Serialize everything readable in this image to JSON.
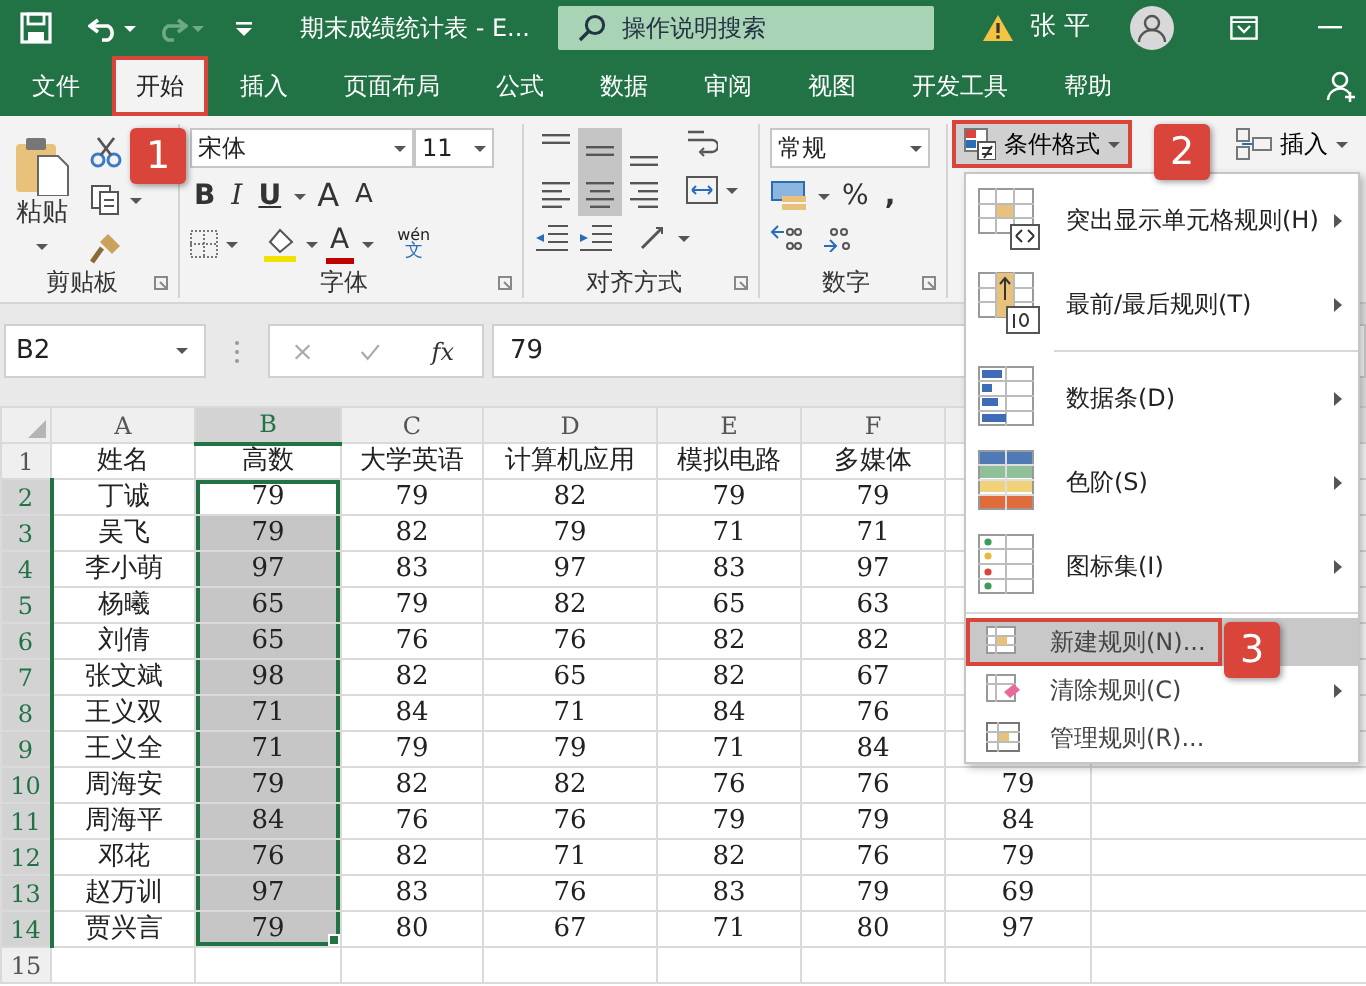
{
  "title_bar": {
    "document_title": "期末成绩统计表 - E...",
    "search": {
      "placeholder": "操作说明搜索"
    },
    "user_name": "张 平"
  },
  "tabs": [
    {
      "label": "文件",
      "selected": false,
      "annotated": false
    },
    {
      "label": "开始",
      "selected": true,
      "annotated": true
    },
    {
      "label": "插入",
      "selected": false,
      "annotated": false
    },
    {
      "label": "页面布局",
      "selected": false,
      "annotated": false
    },
    {
      "label": "公式",
      "selected": false,
      "annotated": false
    },
    {
      "label": "数据",
      "selected": false,
      "annotated": false
    },
    {
      "label": "审阅",
      "selected": false,
      "annotated": false
    },
    {
      "label": "视图",
      "selected": false,
      "annotated": false
    },
    {
      "label": "开发工具",
      "selected": false,
      "annotated": false
    },
    {
      "label": "帮助",
      "selected": false,
      "annotated": false
    }
  ],
  "ribbon": {
    "clipboard": {
      "label": "剪贴板",
      "paste": "粘贴"
    },
    "font": {
      "label": "字体",
      "font_name": "宋体",
      "font_size": "11",
      "bold": "B",
      "italic": "I",
      "underline": "U",
      "grow_font": "A",
      "shrink_font": "A",
      "font_color": "A",
      "phonetic": "wén",
      "phonetic_char": "文"
    },
    "alignment": {
      "label": "对齐方式",
      "buttons": [
        {
          "kind": "top",
          "selected": false
        },
        {
          "kind": "middle",
          "selected": true
        },
        {
          "kind": "bottom",
          "selected": false
        },
        {
          "kind": "left",
          "selected": false
        },
        {
          "kind": "center",
          "selected": true
        },
        {
          "kind": "right",
          "selected": false
        }
      ]
    },
    "number": {
      "label": "数字",
      "format": "常规",
      "percent": "%",
      "comma": ","
    },
    "styles": {
      "conditional_formatting": {
        "label": "条件格式",
        "open": true,
        "annotated": true
      },
      "insert": {
        "label": "插入"
      }
    }
  },
  "formula_bar": {
    "name_box": "B2",
    "function_label": "fx",
    "value": "79"
  },
  "sheet": {
    "columns": [
      {
        "label": "A",
        "selected": false
      },
      {
        "label": "B",
        "selected": true
      },
      {
        "label": "C",
        "selected": false
      },
      {
        "label": "D",
        "selected": false
      },
      {
        "label": "E",
        "selected": false
      },
      {
        "label": "F",
        "selected": false
      }
    ],
    "rows": [
      {
        "header": "1",
        "selected": false,
        "cells": [
          "姓名",
          "高数",
          "大学英语",
          "计算机应用",
          "模拟电路",
          "多媒体"
        ]
      },
      {
        "header": "2",
        "selected": true,
        "cells": [
          "丁诚",
          "79",
          "79",
          "82",
          "79",
          "79"
        ]
      },
      {
        "header": "3",
        "selected": true,
        "cells": [
          "吴飞",
          "79",
          "82",
          "79",
          "71",
          "71"
        ]
      },
      {
        "header": "4",
        "selected": true,
        "cells": [
          "李小萌",
          "97",
          "83",
          "97",
          "83",
          "97"
        ]
      },
      {
        "header": "5",
        "selected": true,
        "cells": [
          "杨曦",
          "65",
          "79",
          "82",
          "65",
          "63"
        ]
      },
      {
        "header": "6",
        "selected": true,
        "cells": [
          "刘倩",
          "65",
          "76",
          "76",
          "82",
          "82"
        ]
      },
      {
        "header": "7",
        "selected": true,
        "cells": [
          "张文斌",
          "98",
          "82",
          "65",
          "82",
          "67"
        ]
      },
      {
        "header": "8",
        "selected": true,
        "cells": [
          "王义双",
          "71",
          "84",
          "71",
          "84",
          "76"
        ]
      },
      {
        "header": "9",
        "selected": true,
        "cells": [
          "王义全",
          "71",
          "79",
          "79",
          "71",
          "84"
        ]
      },
      {
        "header": "10",
        "selected": true,
        "cells": [
          "周海安",
          "79",
          "82",
          "82",
          "76",
          "76",
          "79"
        ]
      },
      {
        "header": "11",
        "selected": true,
        "cells": [
          "周海平",
          "84",
          "76",
          "76",
          "79",
          "79",
          "84"
        ]
      },
      {
        "header": "12",
        "selected": true,
        "cells": [
          "邓花",
          "76",
          "82",
          "71",
          "82",
          "76",
          "79"
        ]
      },
      {
        "header": "13",
        "selected": true,
        "cells": [
          "赵万训",
          "97",
          "83",
          "76",
          "83",
          "79",
          "69"
        ]
      },
      {
        "header": "14",
        "selected": true,
        "cells": [
          "贾兴言",
          "79",
          "80",
          "67",
          "71",
          "80",
          "97"
        ]
      },
      {
        "header": "15",
        "selected": false
      }
    ]
  },
  "menu": {
    "items": [
      {
        "label": "突出显示单元格规则(H)",
        "kind": "large",
        "submenu": true,
        "divider_above": false,
        "selected": false,
        "annotated": false
      },
      {
        "label": "最前/最后规则(T)",
        "kind": "large",
        "submenu": true,
        "divider_above": false,
        "selected": false,
        "annotated": false
      },
      {
        "label": "数据条(D)",
        "kind": "large",
        "submenu": true,
        "divider_above": true,
        "selected": false,
        "annotated": false
      },
      {
        "label": "色阶(S)",
        "kind": "large",
        "submenu": true,
        "divider_above": false,
        "selected": false,
        "annotated": false
      },
      {
        "label": "图标集(I)",
        "kind": "large",
        "submenu": true,
        "divider_above": false,
        "selected": false,
        "annotated": false
      },
      {
        "label": "新建规则(N)...",
        "kind": "small",
        "submenu": false,
        "divider_above": true,
        "selected": true,
        "annotated": true
      },
      {
        "label": "清除规则(C)",
        "kind": "small",
        "submenu": true,
        "divider_above": false,
        "selected": false,
        "annotated": false
      },
      {
        "label": "管理规则(R)...",
        "kind": "small",
        "submenu": false,
        "divider_above": false,
        "selected": false,
        "annotated": false
      }
    ]
  },
  "callouts": [
    "1",
    "2",
    "3"
  ]
}
